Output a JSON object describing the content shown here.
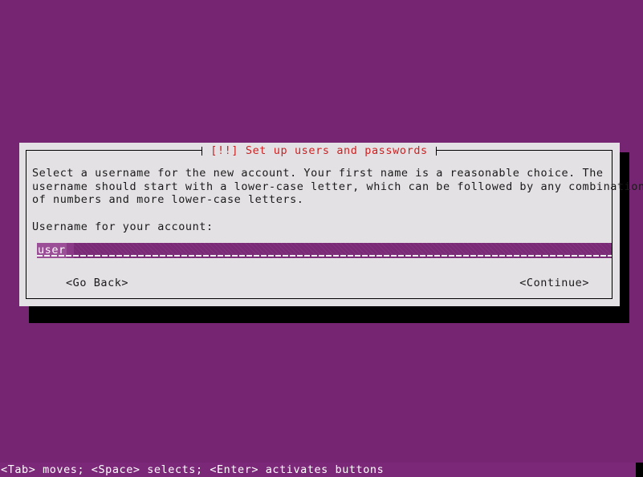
{
  "screen": {
    "background_color": "#762572",
    "kind": "debian-installer-text-mode"
  },
  "dialog": {
    "title": "[!!] Set up users and passwords",
    "title_color": "#cc2222",
    "background_color": "#e4e1e4",
    "border_color": "#000000",
    "body_lines": [
      "Select a username for the new account. Your first name is a reasonable choice. The",
      "username should start with a lower-case letter, which can be followed by any combination",
      "of numbers and more lower-case letters."
    ],
    "prompt_label": "Username for your account:",
    "input": {
      "value": "user",
      "selected": true,
      "field_color": "#7a2a76",
      "selection_color": "#9b4f97",
      "text_color": "#ffffff"
    },
    "buttons": {
      "go_back": "<Go Back>",
      "continue": "<Continue>"
    }
  },
  "status_bar": {
    "hint": "<Tab> moves; <Space> selects; <Enter> activates buttons",
    "background_color": "#7b2878",
    "text_color": "#ffffff"
  }
}
